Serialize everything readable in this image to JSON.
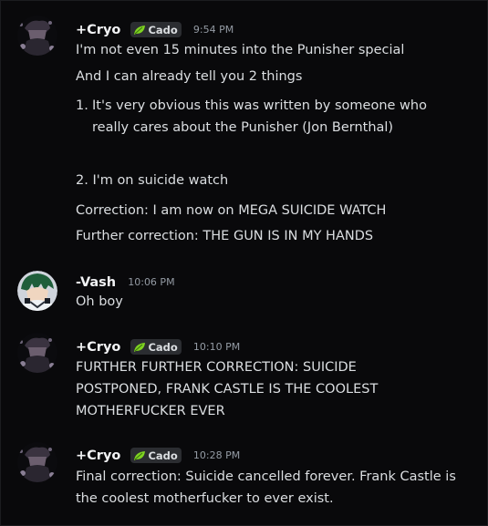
{
  "messages": [
    {
      "author": "+Cryo",
      "tag": "Cado",
      "time": "9:54 PM",
      "lines": [
        "I'm not even 15 minutes into the Punisher special",
        "And I can already tell you 2 things"
      ],
      "list_item": {
        "number": "1.",
        "lines": [
          "It's very obvious this was written by someone who",
          "really cares about the Punisher (Jon Bernthal)"
        ]
      },
      "more_lines": [
        "2. I'm on suicide watch",
        "Correction: I am now on MEGA SUICIDE WATCH",
        "Further correction: THE GUN IS IN MY HANDS"
      ]
    },
    {
      "author": "-Vash",
      "time": "10:06 PM",
      "lines": [
        "Oh boy"
      ]
    },
    {
      "author": "+Cryo",
      "tag": "Cado",
      "time": "10:10 PM",
      "lines": [
        "FURTHER FURTHER CORRECTION: SUICIDE",
        "POSTPONED, FRANK CASTLE IS THE COOLEST",
        "MOTHERFUCKER EVER"
      ]
    },
    {
      "author": "+Cryo",
      "tag": "Cado",
      "time": "10:28 PM",
      "lines": [
        "Final correction: Suicide cancelled forever. Frank Castle is",
        "the coolest motherfucker to ever exist."
      ]
    }
  ],
  "colors": {
    "background": "#09090b",
    "text": "#dbdee1",
    "author": "#f2f3f5",
    "timestamp": "#949ba4",
    "tag_background": "#2b2d31",
    "leaf_icon": "#7ed321"
  },
  "icons": {
    "tag": "leaf-icon"
  }
}
